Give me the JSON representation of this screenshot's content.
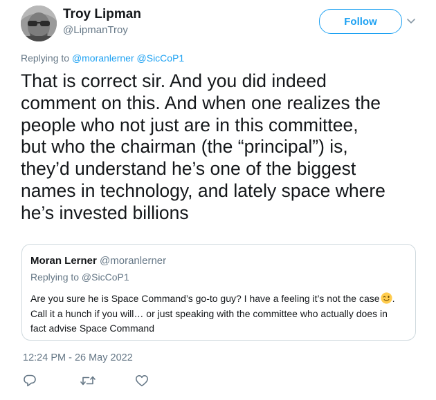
{
  "author": {
    "name": "Troy Lipman",
    "handle": "@LipmanTroy"
  },
  "header": {
    "follow_label": "Follow",
    "more_icon": "chevron-down-icon"
  },
  "reply_context": {
    "prefix": "Replying to",
    "mentions": [
      "@moranlerner",
      "@SicCoP1"
    ]
  },
  "tweet_text_lines": [
    "That is correct sir. And you did indeed",
    "comment on this. And when one realizes the",
    "people who not just are in this committee,",
    "but who the chairman (the “principal”) is,",
    "they’d understand he’s one of the biggest",
    "names in technology, and lately space where",
    "he’s invested billions"
  ],
  "quoted_tweet": {
    "name": "Moran Lerner",
    "handle": "@moranlerner",
    "replying_to": "Replying to @SicCoP1",
    "text_lines": [
      "Are you sure he is Space Command’s go-to guy? I have a feeling it’s not the case",
      "Call it a hunch if you will… or just speaking with the committee who actually does in",
      "fact advise Space Command"
    ],
    "emoji_icon": "winking-face-icon",
    "after_emoji": "."
  },
  "timestamp": "12:24 PM - 26 May 2022",
  "actions": [
    "reply-icon",
    "retweet-icon",
    "like-icon"
  ],
  "colors": {
    "accent": "#1da1f2",
    "secondary_text": "#657786",
    "primary_text": "#14171a",
    "border": "#cfd9de"
  }
}
